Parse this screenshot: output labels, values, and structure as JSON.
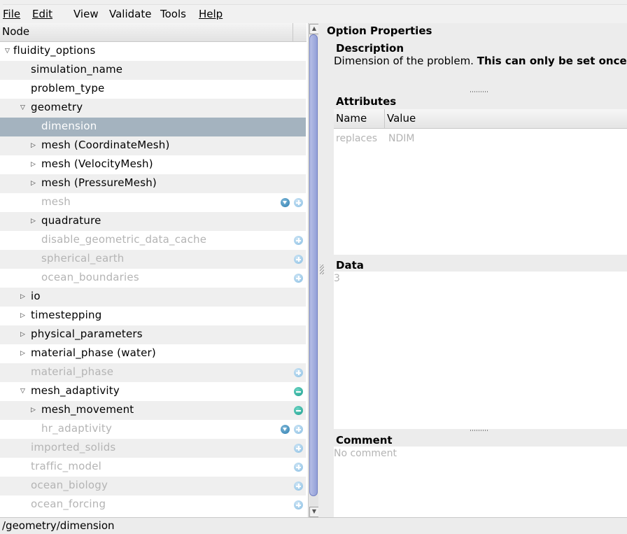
{
  "menu": [
    {
      "label": "File",
      "mnemonic": true
    },
    {
      "label": "Edit",
      "mnemonic": true
    },
    {
      "label": "View",
      "mnemonic": false
    },
    {
      "label": "Validate",
      "mnemonic": false
    },
    {
      "label": "Tools",
      "mnemonic": false
    },
    {
      "label": "Help",
      "mnemonic": true
    }
  ],
  "tree": {
    "header": "Node",
    "rows": [
      {
        "label": "fluidity_options",
        "depth": 0,
        "expander": "expanded",
        "state": "active",
        "icons": []
      },
      {
        "label": "simulation_name",
        "depth": 1,
        "expander": "none",
        "state": "active",
        "icons": []
      },
      {
        "label": "problem_type",
        "depth": 1,
        "expander": "none",
        "state": "active",
        "icons": []
      },
      {
        "label": "geometry",
        "depth": 1,
        "expander": "expanded",
        "state": "active",
        "icons": []
      },
      {
        "label": "dimension",
        "depth": 2,
        "expander": "none",
        "state": "selected",
        "icons": []
      },
      {
        "label": "mesh (CoordinateMesh)",
        "depth": 2,
        "expander": "collapsed",
        "state": "active",
        "icons": []
      },
      {
        "label": "mesh (VelocityMesh)",
        "depth": 2,
        "expander": "collapsed",
        "state": "active",
        "icons": []
      },
      {
        "label": "mesh (PressureMesh)",
        "depth": 2,
        "expander": "collapsed",
        "state": "active",
        "icons": []
      },
      {
        "label": "mesh",
        "depth": 2,
        "expander": "none",
        "state": "inactive",
        "icons": [
          "choice-down-icon",
          "add-icon"
        ]
      },
      {
        "label": "quadrature",
        "depth": 2,
        "expander": "collapsed",
        "state": "active",
        "icons": []
      },
      {
        "label": "disable_geometric_data_cache",
        "depth": 2,
        "expander": "none",
        "state": "inactive",
        "icons": [
          "add-icon"
        ]
      },
      {
        "label": "spherical_earth",
        "depth": 2,
        "expander": "none",
        "state": "inactive",
        "icons": [
          "add-icon"
        ]
      },
      {
        "label": "ocean_boundaries",
        "depth": 2,
        "expander": "none",
        "state": "inactive",
        "icons": [
          "add-icon"
        ]
      },
      {
        "label": "io",
        "depth": 1,
        "expander": "collapsed",
        "state": "active",
        "icons": []
      },
      {
        "label": "timestepping",
        "depth": 1,
        "expander": "collapsed",
        "state": "active",
        "icons": []
      },
      {
        "label": "physical_parameters",
        "depth": 1,
        "expander": "collapsed",
        "state": "active",
        "icons": []
      },
      {
        "label": "material_phase (water)",
        "depth": 1,
        "expander": "collapsed",
        "state": "active",
        "icons": []
      },
      {
        "label": "material_phase",
        "depth": 1,
        "expander": "none",
        "state": "inactive",
        "icons": [
          "add-icon"
        ]
      },
      {
        "label": "mesh_adaptivity",
        "depth": 1,
        "expander": "expanded",
        "state": "active",
        "icons": [
          "remove-icon"
        ]
      },
      {
        "label": "mesh_movement",
        "depth": 2,
        "expander": "collapsed",
        "state": "active",
        "icons": [
          "remove-icon"
        ]
      },
      {
        "label": "hr_adaptivity",
        "depth": 2,
        "expander": "none",
        "state": "inactive",
        "icons": [
          "choice-down-icon",
          "add-icon"
        ]
      },
      {
        "label": "imported_solids",
        "depth": 1,
        "expander": "none",
        "state": "inactive",
        "icons": [
          "add-icon"
        ]
      },
      {
        "label": "traffic_model",
        "depth": 1,
        "expander": "none",
        "state": "inactive",
        "icons": [
          "add-icon"
        ]
      },
      {
        "label": "ocean_biology",
        "depth": 1,
        "expander": "none",
        "state": "inactive",
        "icons": [
          "add-icon"
        ]
      },
      {
        "label": "ocean_forcing",
        "depth": 1,
        "expander": "none",
        "state": "inactive",
        "icons": [
          "add-icon"
        ]
      }
    ]
  },
  "properties": {
    "title": "Option Properties",
    "description_title": "Description",
    "description_plain": "Dimension of the problem. ",
    "description_bold": "This can only be set once",
    "attributes_title": "Attributes",
    "attr_columns": [
      "Name",
      "Value"
    ],
    "attributes": [
      {
        "name": "replaces",
        "value": "NDIM"
      }
    ],
    "data_title": "Data",
    "data_value": "3",
    "comment_title": "Comment",
    "comment_value": "No comment"
  },
  "status": "/geometry/dimension"
}
